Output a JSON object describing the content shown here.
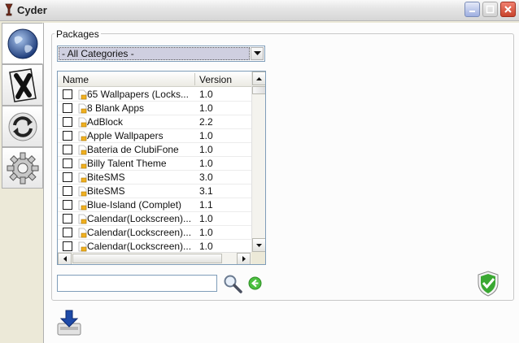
{
  "window": {
    "title": "Cyder"
  },
  "sidebar": {
    "tabs": [
      {
        "name": "browse",
        "icon": "globe-icon"
      },
      {
        "name": "cydia",
        "icon": "x-logo-icon"
      },
      {
        "name": "refresh",
        "icon": "refresh-icon"
      },
      {
        "name": "settings",
        "icon": "gear-icon"
      }
    ]
  },
  "packages": {
    "group_label": "Packages",
    "category_selected": "- All Categories -",
    "columns": {
      "name": "Name",
      "version": "Version"
    },
    "rows": [
      {
        "name": "65 Wallpapers (Locks...",
        "version": "1.0"
      },
      {
        "name": "8 Blank Apps",
        "version": "1.0"
      },
      {
        "name": "AdBlock",
        "version": "2.2"
      },
      {
        "name": "Apple Wallpapers",
        "version": "1.0"
      },
      {
        "name": "Bateria de ClubiFone",
        "version": "1.0"
      },
      {
        "name": "Billy Talent Theme",
        "version": "1.0"
      },
      {
        "name": "BiteSMS",
        "version": "3.0"
      },
      {
        "name": "BiteSMS",
        "version": "3.1"
      },
      {
        "name": "Blue-Island (Complet)",
        "version": "1.1"
      },
      {
        "name": "Calendar(Lockscreen)...",
        "version": "1.0"
      },
      {
        "name": "Calendar(Lockscreen)...",
        "version": "1.0"
      },
      {
        "name": "Calendar(Lockscreen)...",
        "version": "1.0"
      }
    ],
    "search": {
      "value": "",
      "placeholder": ""
    }
  },
  "colors": {
    "accent": "#1a5fb4",
    "check_green": "#3aa832",
    "back_green": "#38b030"
  }
}
